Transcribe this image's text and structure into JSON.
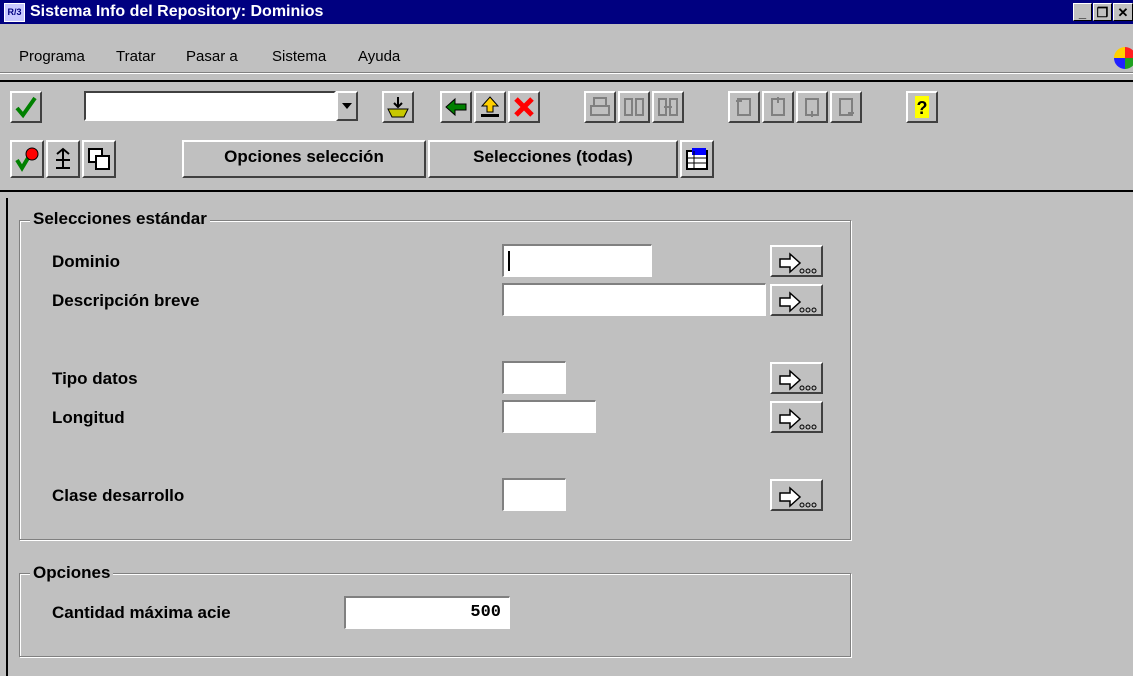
{
  "window": {
    "title": "Sistema Info del Repository: Dominios",
    "app_icon_text": "R/3"
  },
  "menu": {
    "items": [
      "Programa",
      "Tratar",
      "Pasar a",
      "Sistema",
      "Ayuda"
    ]
  },
  "toolbar": {
    "command_field_value": ""
  },
  "app_toolbar": {
    "options_label": "Opciones selección",
    "all_selections_label": "Selecciones (todas)"
  },
  "selections": {
    "title": "Selecciones estándar",
    "fields": [
      {
        "label": "Dominio",
        "value": ""
      },
      {
        "label": "Descripción breve",
        "value": ""
      },
      {
        "label": "Tipo datos",
        "value": ""
      },
      {
        "label": "Longitud",
        "value": ""
      },
      {
        "label": "Clase desarrollo",
        "value": ""
      }
    ]
  },
  "options": {
    "title": "Opciones",
    "max_label": "Cantidad máxima acie",
    "max_value": "500"
  },
  "colors": {
    "titlebar": "#000080",
    "face": "#c0c0c0",
    "check_green": "#008000",
    "cancel_red": "#ff0000"
  },
  "icons": [
    "check-icon",
    "dropdown-arrow-icon",
    "save-icon",
    "back-icon",
    "exit-icon",
    "cancel-icon",
    "print-icon",
    "find-icon",
    "find-next-icon",
    "first-page-icon",
    "prev-page-icon",
    "next-page-icon",
    "last-page-icon",
    "help-icon",
    "execute-icon",
    "info-icon",
    "copy-icon",
    "layout-icon",
    "multiple-selection-icon"
  ]
}
